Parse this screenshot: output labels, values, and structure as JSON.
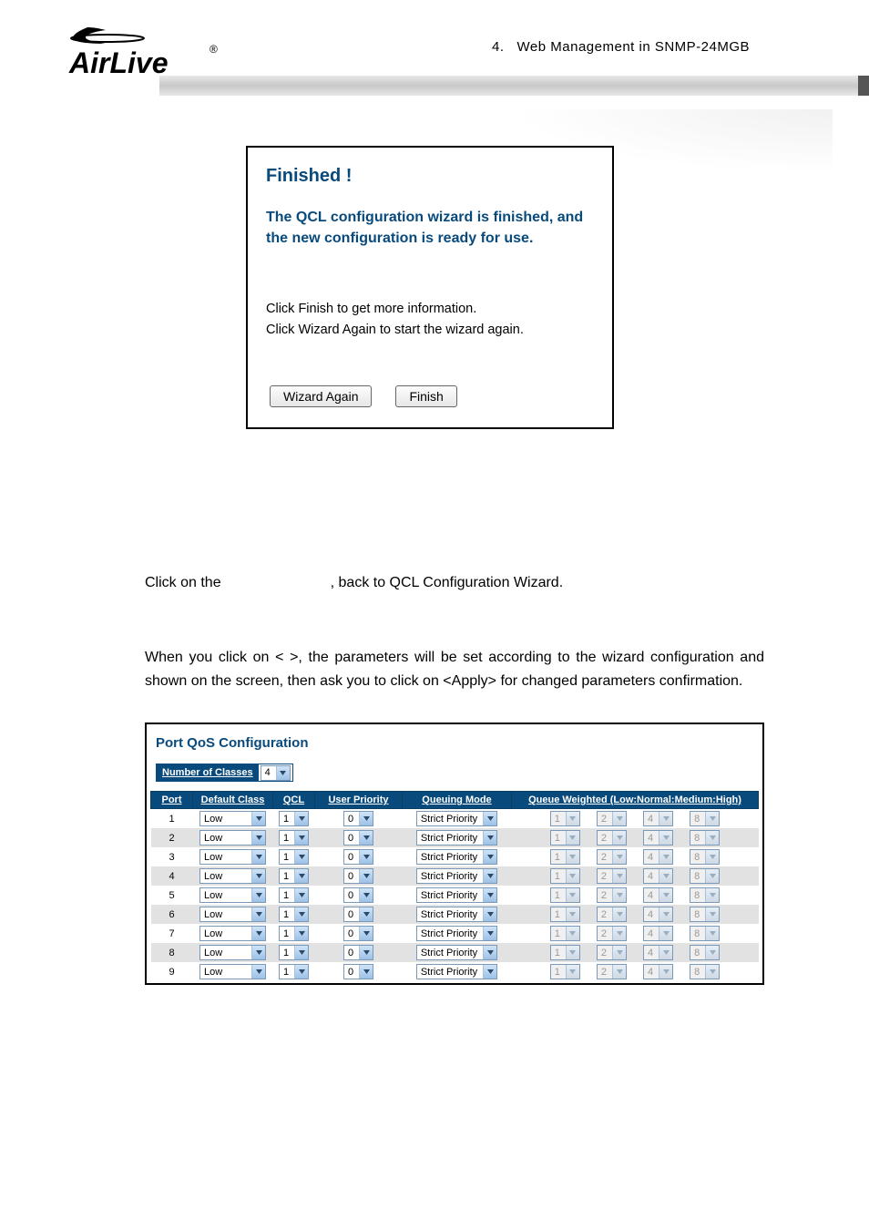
{
  "breadcrumb": {
    "index": "4.",
    "title": "Web  Management  in  SNMP-24MGB"
  },
  "wizard": {
    "title": "Finished !",
    "subtitle": "The QCL configuration wizard is finished, and the new configuration is ready for use.",
    "hint_line1": "Click Finish to get more information.",
    "hint_line2": "Click Wizard Again to start the wizard again.",
    "btn_again": "Wizard Again",
    "btn_finish": "Finish"
  },
  "paragraphs": {
    "p1_a": "Click on the ",
    "p1_b": ", back to QCL Configuration Wizard.",
    "p2": "When you click on <          >, the parameters will be set according to the wizard configuration and shown on the screen, then ask you to click on <Apply> for changed parameters confirmation."
  },
  "qos": {
    "title": "Port QoS Configuration",
    "num_classes_label": "Number of Classes",
    "num_classes_value": "4",
    "headers": {
      "port": "Port",
      "default_class": "Default Class",
      "qcl": "QCL",
      "user_priority": "User Priority",
      "queuing_mode": "Queuing Mode",
      "queue_weighted": "Queue Weighted (Low:Normal:Medium:High)"
    },
    "rows": [
      {
        "port": "1",
        "default_class": "Low",
        "qcl": "1",
        "user_priority": "0",
        "queuing_mode": "Strict Priority",
        "w": [
          "1",
          "2",
          "4",
          "8"
        ]
      },
      {
        "port": "2",
        "default_class": "Low",
        "qcl": "1",
        "user_priority": "0",
        "queuing_mode": "Strict Priority",
        "w": [
          "1",
          "2",
          "4",
          "8"
        ]
      },
      {
        "port": "3",
        "default_class": "Low",
        "qcl": "1",
        "user_priority": "0",
        "queuing_mode": "Strict Priority",
        "w": [
          "1",
          "2",
          "4",
          "8"
        ]
      },
      {
        "port": "4",
        "default_class": "Low",
        "qcl": "1",
        "user_priority": "0",
        "queuing_mode": "Strict Priority",
        "w": [
          "1",
          "2",
          "4",
          "8"
        ]
      },
      {
        "port": "5",
        "default_class": "Low",
        "qcl": "1",
        "user_priority": "0",
        "queuing_mode": "Strict Priority",
        "w": [
          "1",
          "2",
          "4",
          "8"
        ]
      },
      {
        "port": "6",
        "default_class": "Low",
        "qcl": "1",
        "user_priority": "0",
        "queuing_mode": "Strict Priority",
        "w": [
          "1",
          "2",
          "4",
          "8"
        ]
      },
      {
        "port": "7",
        "default_class": "Low",
        "qcl": "1",
        "user_priority": "0",
        "queuing_mode": "Strict Priority",
        "w": [
          "1",
          "2",
          "4",
          "8"
        ]
      },
      {
        "port": "8",
        "default_class": "Low",
        "qcl": "1",
        "user_priority": "0",
        "queuing_mode": "Strict Priority",
        "w": [
          "1",
          "2",
          "4",
          "8"
        ]
      },
      {
        "port": "9",
        "default_class": "Low",
        "qcl": "1",
        "user_priority": "0",
        "queuing_mode": "Strict Priority",
        "w": [
          "1",
          "2",
          "4",
          "8"
        ]
      }
    ]
  }
}
